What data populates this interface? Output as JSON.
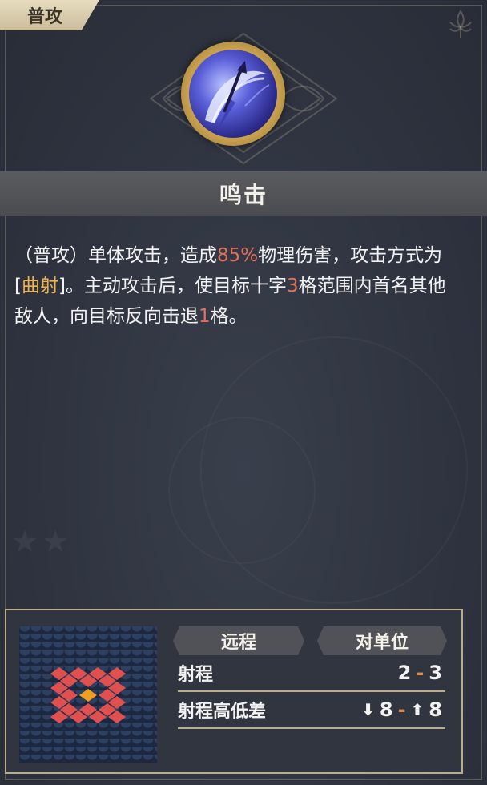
{
  "category_tag": "普攻",
  "skill": {
    "name": "鸣击",
    "icon": "bow-arc-icon"
  },
  "description": {
    "p1": "（普攻）单体攻击，造成",
    "damage_pct": "85%",
    "p2": "物理伤害，攻击方式为[",
    "attack_mode": "曲射",
    "p3": "]。主动攻击后，使目标十字",
    "cross_range": "3",
    "p4": "格范围内首名其他敌人，向目标反向击退",
    "knockback": "1",
    "p5": "格。"
  },
  "tags": [
    "远程",
    "对单位"
  ],
  "stats": {
    "range_label": "射程",
    "range_min": "2",
    "range_max": "3",
    "range_sep": "-",
    "height_label": "射程高低差",
    "height_down": "8",
    "height_up": "8",
    "height_sep": "-",
    "down_icon": "arrow-down-icon",
    "up_icon": "arrow-up-icon"
  },
  "colors": {
    "highlight_number": "#e0725a",
    "highlight_keyword": "#f0b24a",
    "range_cell": "#e0504f",
    "center_cell": "#f0a020",
    "frame_gold": "#b9ad8e"
  }
}
